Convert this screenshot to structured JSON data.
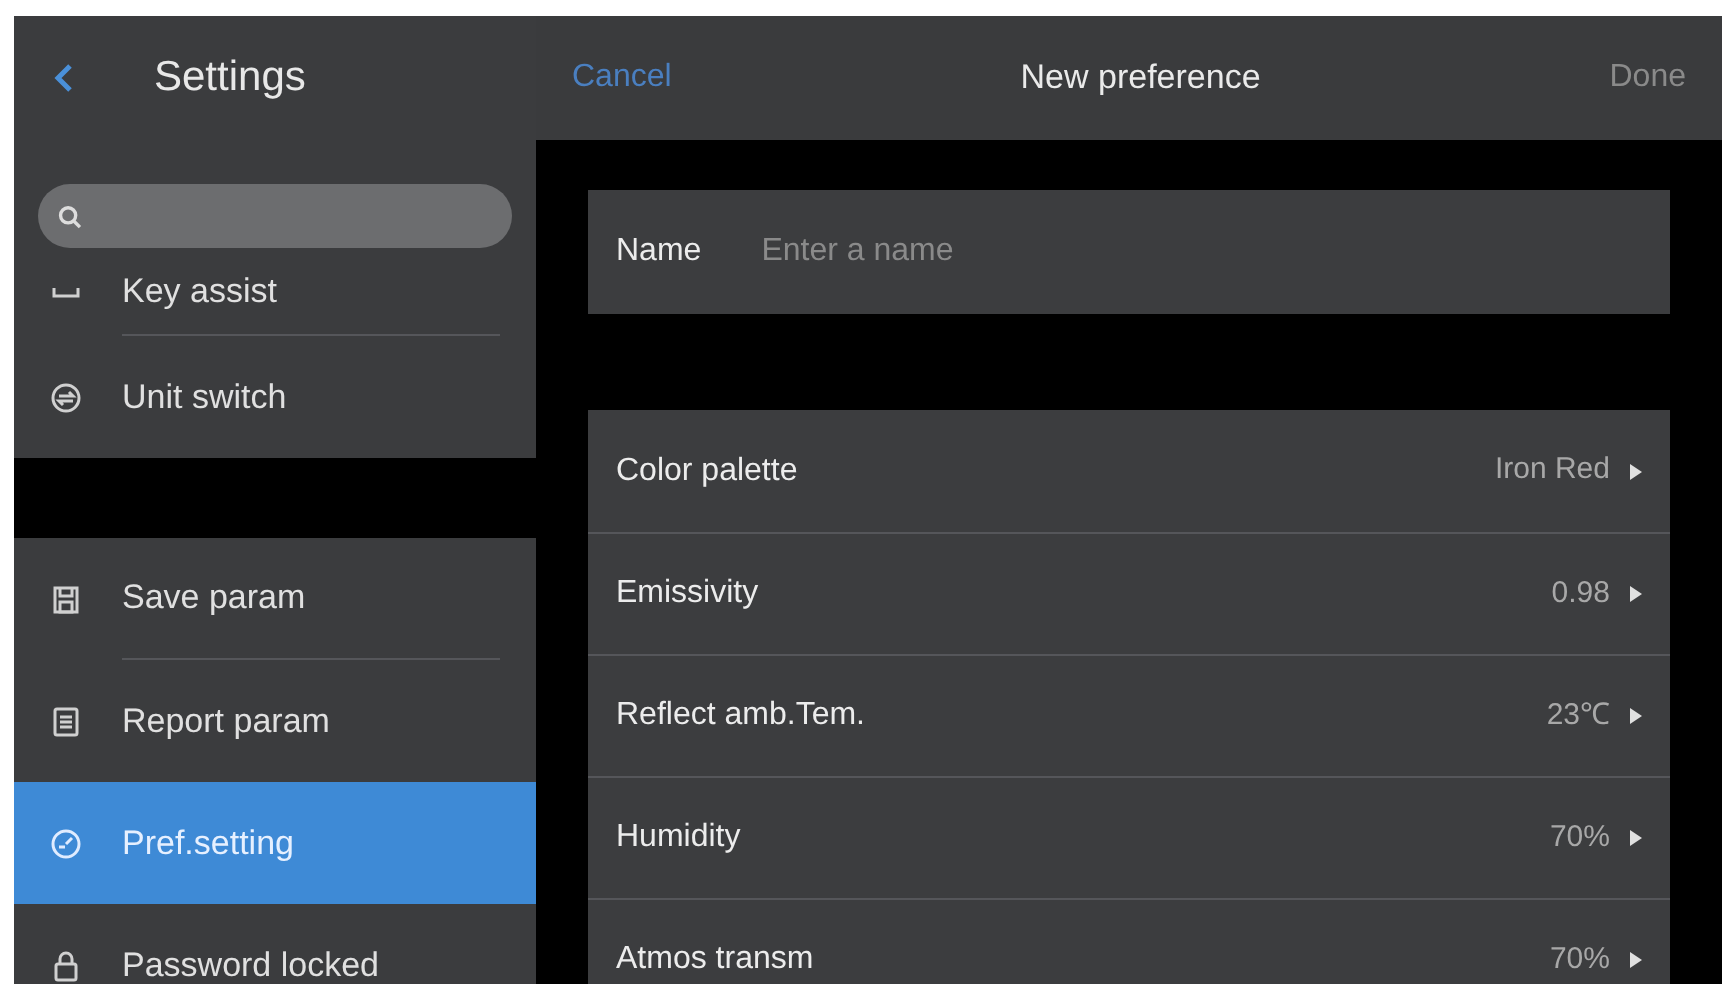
{
  "sidebar": {
    "title": "Settings",
    "groups": [
      [
        {
          "label": "Key assist",
          "selected": false
        },
        {
          "label": "Unit switch",
          "selected": false
        }
      ],
      [
        {
          "label": "Save param",
          "selected": false
        },
        {
          "label": "Report param",
          "selected": false
        },
        {
          "label": "Pref.setting",
          "selected": true
        },
        {
          "label": "Password locked",
          "selected": false
        }
      ]
    ]
  },
  "header": {
    "cancel": "Cancel",
    "title": "New preference",
    "done": "Done"
  },
  "name_field": {
    "label": "Name",
    "placeholder": "Enter a name"
  },
  "settings": [
    {
      "label": "Color palette",
      "value": "Iron Red"
    },
    {
      "label": "Emissivity",
      "value": "0.98"
    },
    {
      "label": "Reflect amb.Tem.",
      "value": "23℃"
    },
    {
      "label": "Humidity",
      "value": "70%"
    },
    {
      "label": "Atmos transm",
      "value": "70%"
    }
  ]
}
